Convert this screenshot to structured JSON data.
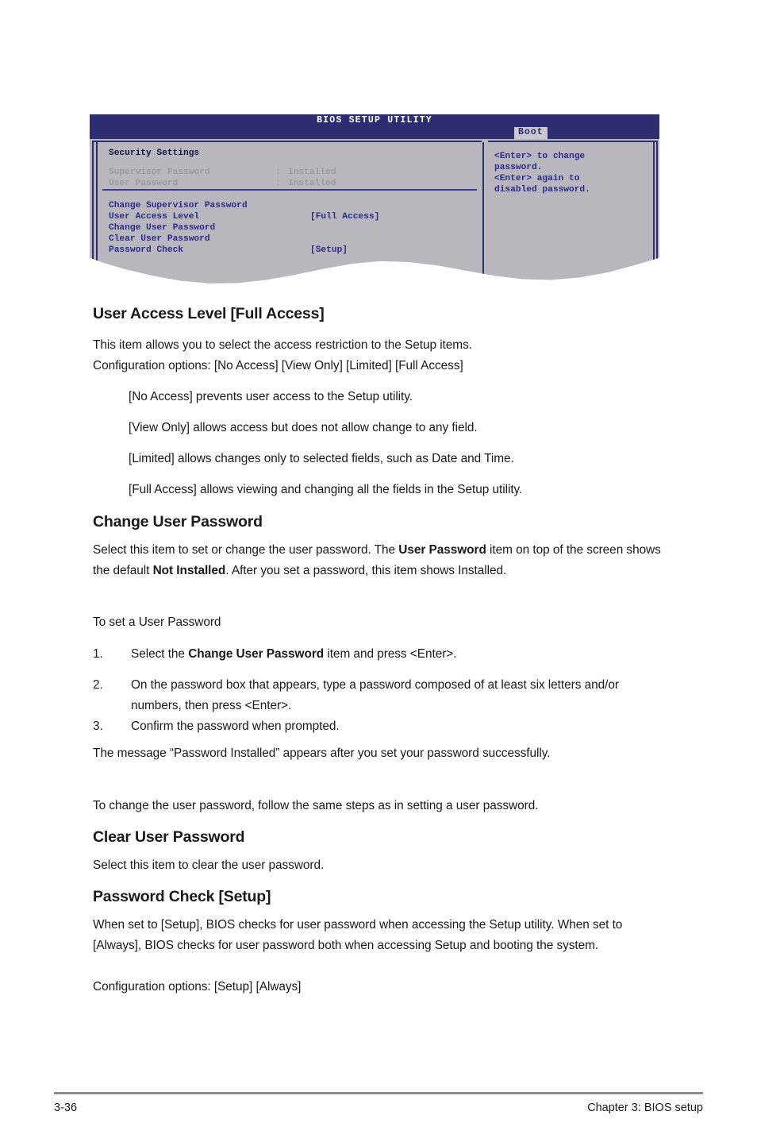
{
  "bios": {
    "title": "BIOS SETUP UTILITY",
    "active_tab": "Boot",
    "section_title": "Security Settings",
    "status_rows": [
      {
        "label": "Supervisor Password",
        "separator": ":",
        "value": "Installed"
      },
      {
        "label": "User Password",
        "separator": ":",
        "value": "Installed"
      }
    ],
    "menu_rows": [
      {
        "label": "Change Supervisor Password",
        "value": ""
      },
      {
        "label": "User Access Level",
        "value": "[Full Access]"
      },
      {
        "label": "Change User Password",
        "value": ""
      },
      {
        "label": "Clear User Password",
        "value": ""
      },
      {
        "label": "Password Check",
        "value": "[Setup]"
      }
    ],
    "help_lines": [
      "<Enter> to change",
      "password.",
      "<Enter> again to",
      "disabled password."
    ],
    "colors": {
      "header_bg": "#2e2d72",
      "panel_bg": "#b7b7bd",
      "text_blue": "#2b2a8f",
      "text_dim": "#9a9aa2",
      "tab_bg": "#c8c8cd"
    }
  },
  "doc": {
    "s1": {
      "heading": "User Access Level [Full Access]",
      "para1_line1": "This item allows you to select the access restriction to the Setup items.",
      "para1_line2": "Configuration options: [No Access] [View Only] [Limited] [Full Access]",
      "bullets": [
        "[No Access] prevents user access to the Setup utility.",
        "[View Only] allows access but does not allow change to any field.",
        "[Limited] allows changes only to selected fields, such as Date and Time.",
        "[Full Access] allows viewing and changing all the fields in the Setup utility."
      ]
    },
    "s2": {
      "heading": "Change User Password",
      "para_a1": "Select this item to set or change the user password. The ",
      "para_a_b1": "User Password",
      "para_a2": " item on top of the screen shows the default ",
      "para_a_b2": "Not Installed",
      "para_a3": ". After you set a password, this item shows Installed.",
      "para_b": "To set a User Password",
      "steps": [
        {
          "num": "1.",
          "pre": "Select the ",
          "bold": "Change User Password",
          "post": " item and press <Enter>."
        },
        {
          "num": "2.",
          "pre": "On the password box that appears, type a password composed of at least six letters and/or numbers, then press <Enter>.",
          "bold": "",
          "post": ""
        },
        {
          "num": "3.",
          "pre": "Confirm the password when prompted.",
          "bold": "",
          "post": ""
        }
      ],
      "para_c": "The message “Password Installed” appears after you set your password successfully.",
      "para_d": "To change the user password, follow the same steps as in setting a user password."
    },
    "s3": {
      "heading": "Clear User Password",
      "para": "Select this item to clear the user password."
    },
    "s4": {
      "heading": "Password Check [Setup]",
      "para_line1": "When set to [Setup], BIOS checks for user password when accessing the Setup utility. When set to [Always], BIOS checks for user password both when accessing Setup and booting the system.",
      "para_line2": "Configuration options: [Setup] [Always]"
    }
  },
  "footer": {
    "page_number": "3-36",
    "chapter": "Chapter 3: BIOS setup"
  }
}
